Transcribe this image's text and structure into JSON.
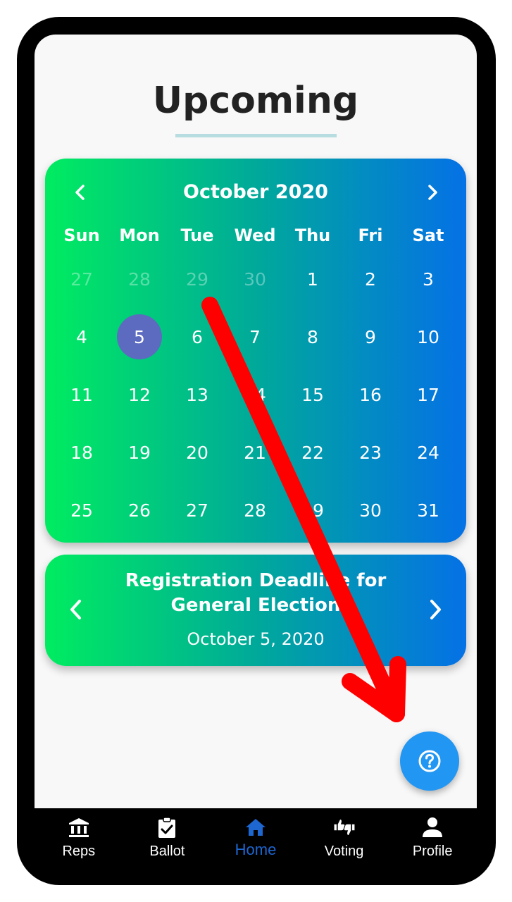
{
  "page": {
    "title": "Upcoming"
  },
  "calendar": {
    "month_label": "October 2020",
    "weekdays": [
      "Sun",
      "Mon",
      "Tue",
      "Wed",
      "Thu",
      "Fri",
      "Sat"
    ],
    "weeks": [
      [
        {
          "d": "27",
          "muted": true
        },
        {
          "d": "28",
          "muted": true
        },
        {
          "d": "29",
          "muted": true
        },
        {
          "d": "30",
          "muted": true
        },
        {
          "d": "1"
        },
        {
          "d": "2"
        },
        {
          "d": "3"
        }
      ],
      [
        {
          "d": "4"
        },
        {
          "d": "5",
          "selected": true
        },
        {
          "d": "6"
        },
        {
          "d": "7"
        },
        {
          "d": "8"
        },
        {
          "d": "9"
        },
        {
          "d": "10"
        }
      ],
      [
        {
          "d": "11"
        },
        {
          "d": "12"
        },
        {
          "d": "13"
        },
        {
          "d": "14"
        },
        {
          "d": "15"
        },
        {
          "d": "16"
        },
        {
          "d": "17"
        }
      ],
      [
        {
          "d": "18"
        },
        {
          "d": "19"
        },
        {
          "d": "20"
        },
        {
          "d": "21"
        },
        {
          "d": "22"
        },
        {
          "d": "23"
        },
        {
          "d": "24"
        }
      ],
      [
        {
          "d": "25"
        },
        {
          "d": "26"
        },
        {
          "d": "27"
        },
        {
          "d": "28"
        },
        {
          "d": "29"
        },
        {
          "d": "30"
        },
        {
          "d": "31"
        }
      ]
    ],
    "selected_color": "#5c6bc0",
    "prev_icon": "chevron-left-icon",
    "next_icon": "chevron-right-icon"
  },
  "event": {
    "title_line1": "Registration Deadline for",
    "title_line2": "General Election",
    "date": "October 5, 2020"
  },
  "fab": {
    "icon": "help-circle-icon",
    "color": "#2196f3"
  },
  "bottom_nav": {
    "items": [
      {
        "label": "Reps",
        "icon": "bank-icon"
      },
      {
        "label": "Ballot",
        "icon": "clipboard-check-icon"
      },
      {
        "label": "Home",
        "icon": "home-icon",
        "active": true
      },
      {
        "label": "Voting",
        "icon": "thumbs-up-down-icon"
      },
      {
        "label": "Profile",
        "icon": "person-icon"
      }
    ],
    "active_color": "#1e66d0"
  },
  "gradient": {
    "start": "#00ec60",
    "middle": "#00a99a",
    "end": "#0571e6"
  },
  "annotation_color": "#ff0000"
}
